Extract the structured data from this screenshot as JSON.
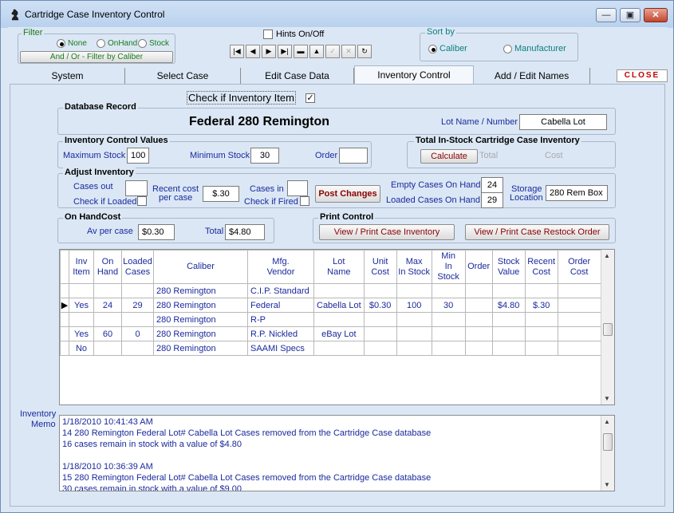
{
  "window": {
    "title": "Cartridge Case Inventory Control",
    "minimize": "—",
    "maximize": "▣",
    "close": "✕"
  },
  "filter": {
    "legend": "Filter",
    "options": [
      "None",
      "OnHand",
      "Stock"
    ],
    "selected": "None",
    "caliber_button": "And / Or - Filter by Caliber"
  },
  "hints": {
    "label": "Hints On/Off",
    "checked": false
  },
  "navigator": [
    "|◀",
    "◀",
    "▶",
    "▶|",
    "▬",
    "▲",
    "✓",
    "✕",
    "↻"
  ],
  "sort": {
    "legend": "Sort by",
    "options": [
      "Caliber",
      "Manufacturer"
    ],
    "selected": "Caliber"
  },
  "tabs": [
    "System",
    "Select Case",
    "Edit Case Data",
    "Inventory Control",
    "Add / Edit Names"
  ],
  "active_tab": "Inventory Control",
  "close_button": "CLOSE",
  "inventory_item": {
    "label": "Check if Inventory Item",
    "checked": "✓"
  },
  "database_record": {
    "legend": "Database Record",
    "record_title": "Federal  280 Remington",
    "lot_label": "Lot Name / Number",
    "lot_value": "Cabella Lot"
  },
  "control_values": {
    "legend": "Inventory Control Values",
    "max_label": "Maximum Stock",
    "max_value": "100",
    "min_label": "Minimum Stock",
    "min_value": "30",
    "order_label": "Order",
    "order_value": ""
  },
  "total_instock": {
    "legend": "Total  In-Stock Cartridge Case Inventory",
    "calculate": "Calculate",
    "total_label": "Total",
    "cost_label": "Cost"
  },
  "adjust": {
    "legend": "Adjust Inventory",
    "cases_out": "Cases out",
    "check_loaded": "Check if Loaded",
    "recent_cost": "Recent cost",
    "per_case": "per case",
    "recent_cost_value": "$.30",
    "cases_in": "Cases in",
    "check_fired": "Check if Fired",
    "post_changes": "Post Changes",
    "empty_label": "Empty Cases On Hand",
    "empty_value": "24",
    "loaded_label": "Loaded Cases On Hand",
    "loaded_value": "29",
    "storage_label1": "Storage",
    "storage_label2": "Location",
    "storage_value": "280 Rem Box"
  },
  "onhand_cost": {
    "legend": "On HandCost",
    "av_label": "Av per case",
    "av_value": "$0.30",
    "total_label": "Total",
    "total_value": "$4.80"
  },
  "print_control": {
    "legend": "Print Control",
    "view_inventory": "View / Print Case Inventory",
    "view_restock": "View / Print Case Restock Order"
  },
  "grid": {
    "headers": [
      [
        "Inv",
        "Item"
      ],
      [
        "On",
        "Hand"
      ],
      [
        "Loaded",
        "Cases"
      ],
      [
        "Caliber",
        ""
      ],
      [
        "Mfg.",
        "Vendor"
      ],
      [
        "Lot",
        "Name"
      ],
      [
        "Unit",
        "Cost"
      ],
      [
        "Max",
        "In Stock"
      ],
      [
        "Min",
        "In Stock"
      ],
      [
        "Order",
        ""
      ],
      [
        "Stock",
        "Value"
      ],
      [
        "Recent",
        "Cost"
      ],
      [
        "Order",
        "Cost"
      ]
    ],
    "rows": [
      {
        "current": false,
        "cells": [
          "",
          "",
          "",
          "280 Remington",
          "C.I.P. Standard",
          "",
          "",
          "",
          "",
          "",
          "",
          "",
          ""
        ]
      },
      {
        "current": true,
        "cells": [
          "Yes",
          "24",
          "29",
          "280 Remington",
          "Federal",
          "Cabella Lot",
          "$0.30",
          "100",
          "30",
          "",
          "$4.80",
          "$.30",
          ""
        ]
      },
      {
        "current": false,
        "cells": [
          "",
          "",
          "",
          "280 Remington",
          "R-P",
          "",
          "",
          "",
          "",
          "",
          "",
          "",
          ""
        ]
      },
      {
        "current": false,
        "cells": [
          "Yes",
          "60",
          "0",
          "280 Remington",
          "R.P. Nickled",
          "eBay Lot",
          "",
          "",
          "",
          "",
          "",
          "",
          ""
        ]
      },
      {
        "current": false,
        "cells": [
          "No",
          "",
          "",
          "280 Remington",
          "SAAMI Specs",
          "",
          "",
          "",
          "",
          "",
          "",
          "",
          ""
        ]
      }
    ]
  },
  "memo": {
    "label1": "Inventory",
    "label2": "Memo",
    "lines": [
      "1/18/2010 10:41:43 AM",
      " 14 280 Remington Federal Lot# Cabella Lot Cases removed from the Cartridge Case database",
      "   16 cases remain in stock with a value of $4.80",
      "",
      "1/18/2010 10:36:39 AM",
      " 15 280 Remington Federal Lot# Cabella Lot Cases removed from the Cartridge Case database",
      "   30 cases remain in stock with a value of $9.00"
    ]
  }
}
